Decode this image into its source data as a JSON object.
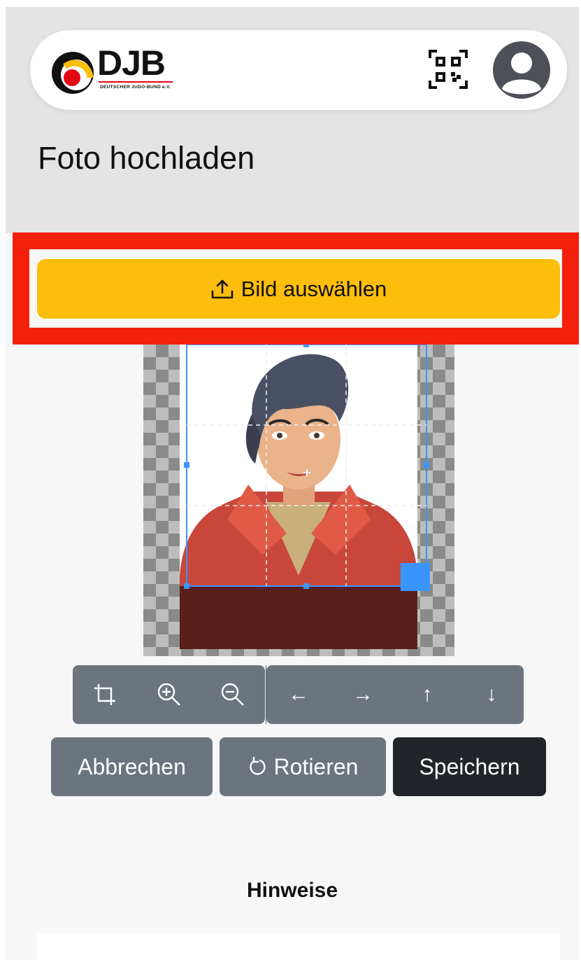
{
  "header": {
    "logo_text": "DJB",
    "logo_subtext": "DEUTSCHER JUDO-BUND e.V.",
    "qr_icon": "qr-code-icon",
    "profile_icon": "user-avatar-icon"
  },
  "page": {
    "title": "Foto hochladen"
  },
  "upload": {
    "select_label": "Bild auswählen",
    "select_icon": "upload-icon"
  },
  "toolbar": {
    "tools": [
      {
        "name": "crop-icon"
      },
      {
        "name": "zoom-in-icon"
      },
      {
        "name": "zoom-out-icon"
      },
      {
        "glyph": "←",
        "name": "arrow-left-icon"
      },
      {
        "glyph": "→",
        "name": "arrow-right-icon"
      },
      {
        "glyph": "↑",
        "name": "arrow-up-icon"
      },
      {
        "glyph": "↓",
        "name": "arrow-down-icon"
      }
    ]
  },
  "actions": {
    "cancel_label": "Abbrechen",
    "rotate_label": "Rotieren",
    "rotate_icon": "rotate-icon",
    "save_label": "Speichern"
  },
  "notes": {
    "heading": "Hinweise"
  },
  "colors": {
    "accent": "#fdbe0b",
    "highlight": "#f3210b",
    "crop_selection": "#3b95ff",
    "toolbar": "#6c757d",
    "save": "#212529"
  }
}
